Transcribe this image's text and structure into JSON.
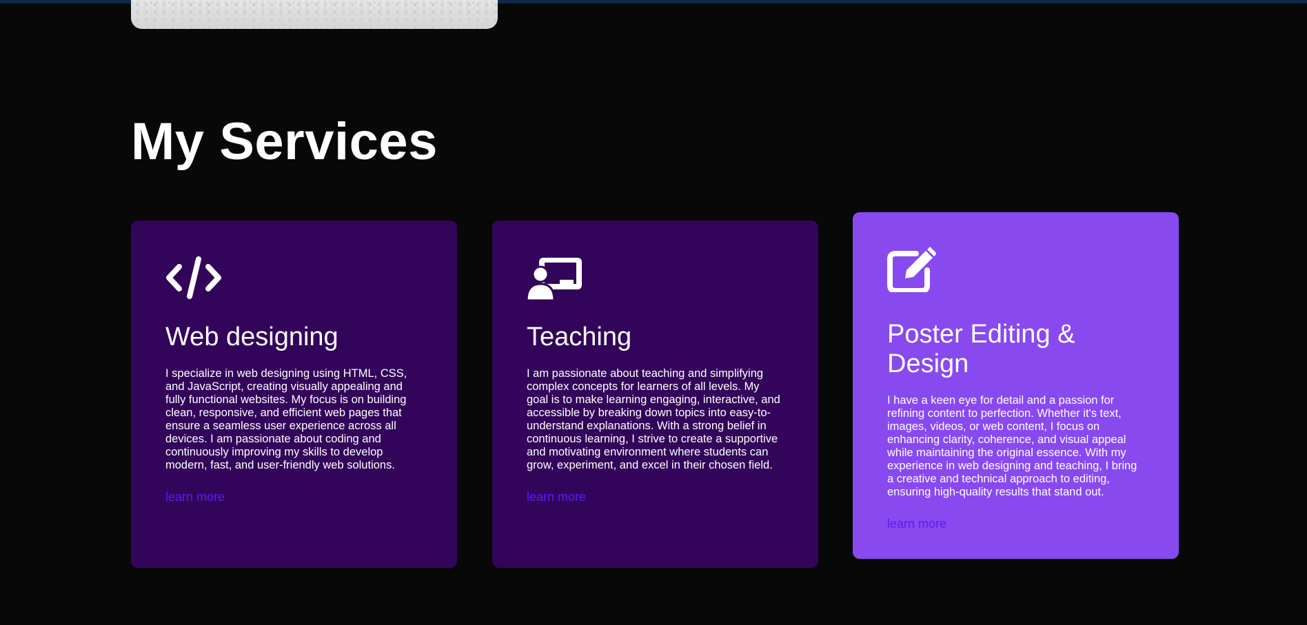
{
  "section": {
    "title": "My Services"
  },
  "colors": {
    "background": "#080808",
    "card_default": "#32055a",
    "card_highlight": "#8849ef",
    "link": "#5b1cf5"
  },
  "services": [
    {
      "icon": "code-icon",
      "title": "Web designing",
      "description": "I specialize in web designing using HTML, CSS, and JavaScript, creating visually appealing and fully functional websites. My focus is on building clean, responsive, and efficient web pages that ensure a seamless user experience across all devices. I am passionate about coding and continuously improving my skills to develop modern, fast, and user-friendly web solutions.",
      "link_label": "learn more"
    },
    {
      "icon": "chalkboard-teacher-icon",
      "title": "Teaching",
      "description": "I am passionate about teaching and simplifying complex concepts for learners of all levels. My goal is to make learning engaging, interactive, and accessible by breaking down topics into easy-to-understand explanations. With a strong belief in continuous learning, I strive to create a supportive and motivating environment where students can grow, experiment, and excel in their chosen field.",
      "link_label": "learn more"
    },
    {
      "icon": "edit-icon",
      "title": "Poster Editing & Design",
      "description": "I have a keen eye for detail and a passion for refining content to perfection. Whether it's text, images, videos, or web content, I focus on enhancing clarity, coherence, and visual appeal while maintaining the original essence. With my experience in web designing and teaching, I bring a creative and technical approach to editing, ensuring high-quality results that stand out.",
      "link_label": "learn more"
    }
  ]
}
